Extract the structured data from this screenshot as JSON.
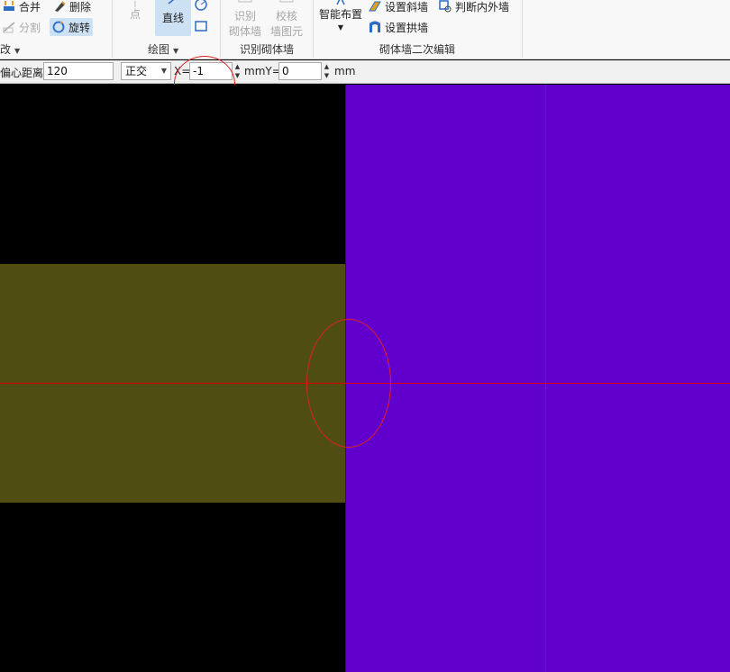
{
  "ribbon": {
    "modify_group": {
      "merge": "合并",
      "delete": "删除",
      "split": "分割",
      "rotate": "旋转",
      "label": "改"
    },
    "draw_group": {
      "point": "点",
      "line": "直线",
      "label": "绘图"
    },
    "recognize_group": {
      "recognize_line1": "识别",
      "recognize_line2": "砌体墙",
      "check_line1": "校核",
      "check_line2": "墙图元",
      "label": "识别砌体墙"
    },
    "edit_group": {
      "smart_layout": "智能布置",
      "set_slant_wall": "设置斜墙",
      "judge_inner_outer": "判断内外墙",
      "set_arch_wall": "设置拱墙",
      "label": "砌体墙二次编辑"
    }
  },
  "toolbar": {
    "offset_label": "偏心距离:",
    "offset_value": "120",
    "mode_value": "正交",
    "x_label": "X=",
    "x_value": "-1",
    "y_label": "mmY=",
    "y_value": "0",
    "unit": "mm"
  },
  "colors": {
    "canvas_bg": "#000000",
    "wall_olive": "#504d12",
    "wall_purple": "#6100cc",
    "crosshair": "#e00000",
    "highlight_circle": "#e02020"
  },
  "icons": [
    "merge-icon",
    "delete-icon",
    "split-icon",
    "rotate-icon",
    "circle-icon",
    "rectangle-icon",
    "smart-layout-icon",
    "slant-wall-icon",
    "judge-wall-icon",
    "arch-wall-icon"
  ]
}
